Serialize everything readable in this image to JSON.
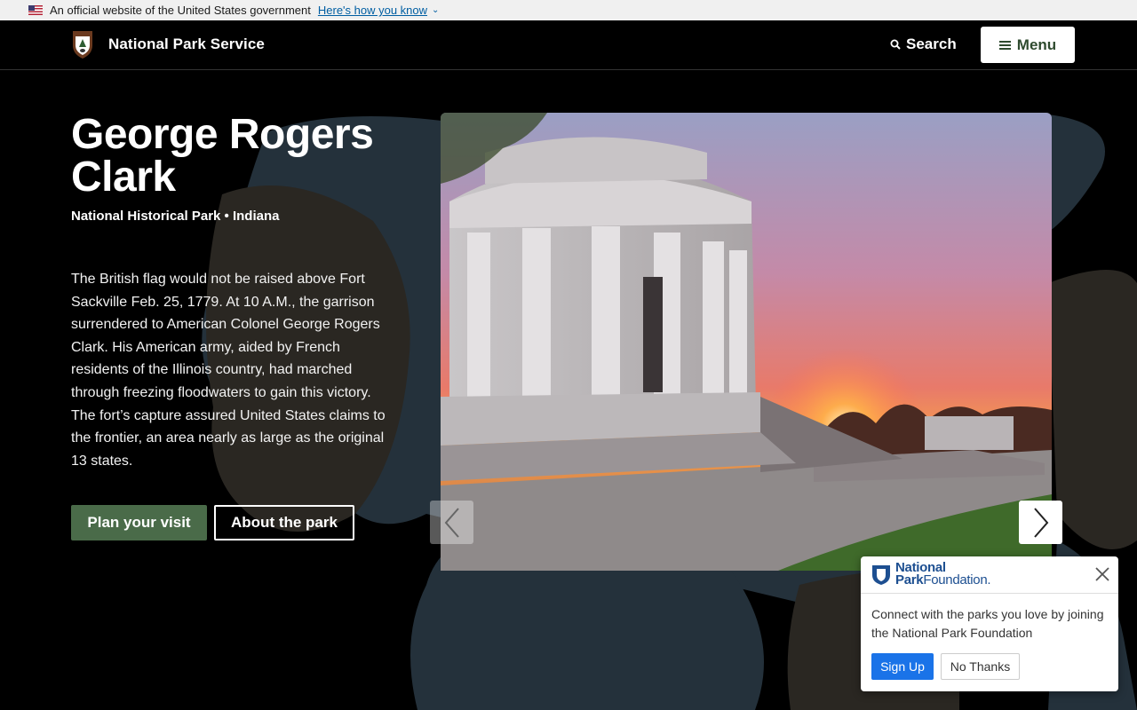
{
  "gov_banner": {
    "text": "An official website of the United States government",
    "link": "Here's how you know",
    "flag_icon": "us-flag-icon",
    "chevron_icon": "chevron-down-icon"
  },
  "header": {
    "site_name": "National Park Service",
    "search_label": "Search",
    "menu_label": "Menu",
    "logo_icon": "nps-arrowhead-icon",
    "search_icon": "search-icon",
    "menu_icon": "hamburger-icon"
  },
  "hero": {
    "title": "George Rogers Clark",
    "subtitle": "National Historical Park • Indiana",
    "description": "The British flag would not be raised above Fort Sackville Feb. 25, 1779. At 10 A.M., the garrison surrendered to American Colonel George Rogers Clark. His American army, aided by French residents of the Illinois country, had marched through freezing floodwaters to gain this victory. The fort’s capture assured United States claims to the frontier, an area nearly as large as the original 13 states.",
    "primary_button": "Plan your visit",
    "secondary_button": "About the park"
  },
  "carousel": {
    "prev_icon": "chevron-left-icon",
    "next_icon": "chevron-right-icon"
  },
  "popup": {
    "brand_line1": "National",
    "brand_line2a": "Park",
    "brand_line2b": "Foundation.",
    "message": "Connect with the parks you love by joining the National Park Foundation",
    "signup_label": "Sign Up",
    "decline_label": "No Thanks",
    "close_icon": "close-icon",
    "shield_icon": "npf-shield-icon"
  },
  "colors": {
    "primary_green": "#4a6b49",
    "blob_slate": "#24313b",
    "blob_olive": "#2a2722",
    "signup_blue": "#1a73e8",
    "npf_blue": "#1d4f91"
  }
}
